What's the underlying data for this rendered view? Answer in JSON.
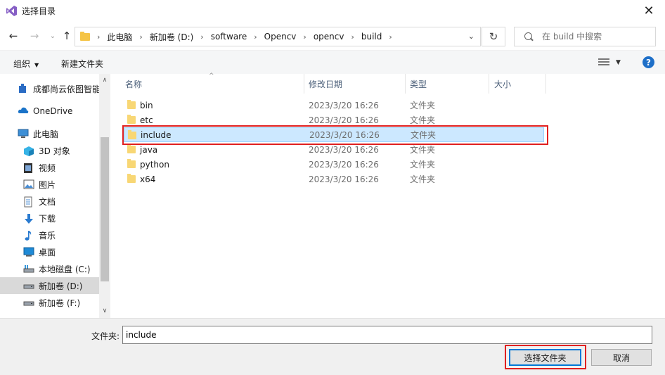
{
  "window": {
    "title": "选择目录",
    "close_glyph": "✕"
  },
  "nav": {
    "back_glyph": "←",
    "forward_glyph": "→",
    "recent_glyph": "⌄",
    "up_glyph": "↑",
    "breadcrumbs": [
      "此电脑",
      "新加卷 (D:)",
      "software",
      "Opencv",
      "opencv",
      "build"
    ],
    "crumb_sep": "›",
    "dropdown_glyph": "⌄",
    "refresh_glyph": "↻",
    "search_placeholder": "在 build 中搜索"
  },
  "toolbar": {
    "organize_label": "组织",
    "organize_caret": "▼",
    "new_folder_label": "新建文件夹",
    "view_caret": "▼",
    "help_label": "?"
  },
  "sidebar": {
    "items": [
      {
        "label": "成都尚云依图智能",
        "icon": "cloud-user-icon",
        "selected": false
      },
      {
        "label": "OneDrive",
        "icon": "onedrive-cloud-icon",
        "selected": false
      },
      {
        "label": "此电脑",
        "icon": "this-pc-icon",
        "selected": false
      },
      {
        "label": "3D 对象",
        "icon": "3d-objects-icon",
        "selected": false
      },
      {
        "label": "视频",
        "icon": "videos-icon",
        "selected": false
      },
      {
        "label": "图片",
        "icon": "pictures-icon",
        "selected": false
      },
      {
        "label": "文档",
        "icon": "documents-icon",
        "selected": false
      },
      {
        "label": "下载",
        "icon": "downloads-icon",
        "selected": false
      },
      {
        "label": "音乐",
        "icon": "music-icon",
        "selected": false
      },
      {
        "label": "桌面",
        "icon": "desktop-icon",
        "selected": false
      },
      {
        "label": "本地磁盘 (C:)",
        "icon": "local-disk-icon",
        "selected": false
      },
      {
        "label": "新加卷 (D:)",
        "icon": "drive-icon",
        "selected": true
      },
      {
        "label": "新加卷 (F:)",
        "icon": "drive-icon",
        "selected": false
      }
    ],
    "scroll_up_glyph": "∧",
    "scroll_down_glyph": "∨"
  },
  "filelist": {
    "sort_glyph": "^",
    "columns": {
      "name": "名称",
      "modified": "修改日期",
      "type": "类型",
      "size": "大小"
    },
    "rows": [
      {
        "name": "bin",
        "modified": "2023/3/20 16:26",
        "type": "文件夹",
        "selected": false
      },
      {
        "name": "etc",
        "modified": "2023/3/20 16:26",
        "type": "文件夹",
        "selected": false
      },
      {
        "name": "include",
        "modified": "2023/3/20 16:26",
        "type": "文件夹",
        "selected": true
      },
      {
        "name": "java",
        "modified": "2023/3/20 16:26",
        "type": "文件夹",
        "selected": false
      },
      {
        "name": "python",
        "modified": "2023/3/20 16:26",
        "type": "文件夹",
        "selected": false
      },
      {
        "name": "x64",
        "modified": "2023/3/20 16:26",
        "type": "文件夹",
        "selected": false
      }
    ]
  },
  "footer": {
    "folder_label": "文件夹:",
    "folder_value": "include",
    "select_button": "选择文件夹",
    "cancel_button": "取消"
  },
  "colors": {
    "accent": "#0078d7",
    "selection_bg": "#cce8ff",
    "highlight_box": "#e02020"
  }
}
